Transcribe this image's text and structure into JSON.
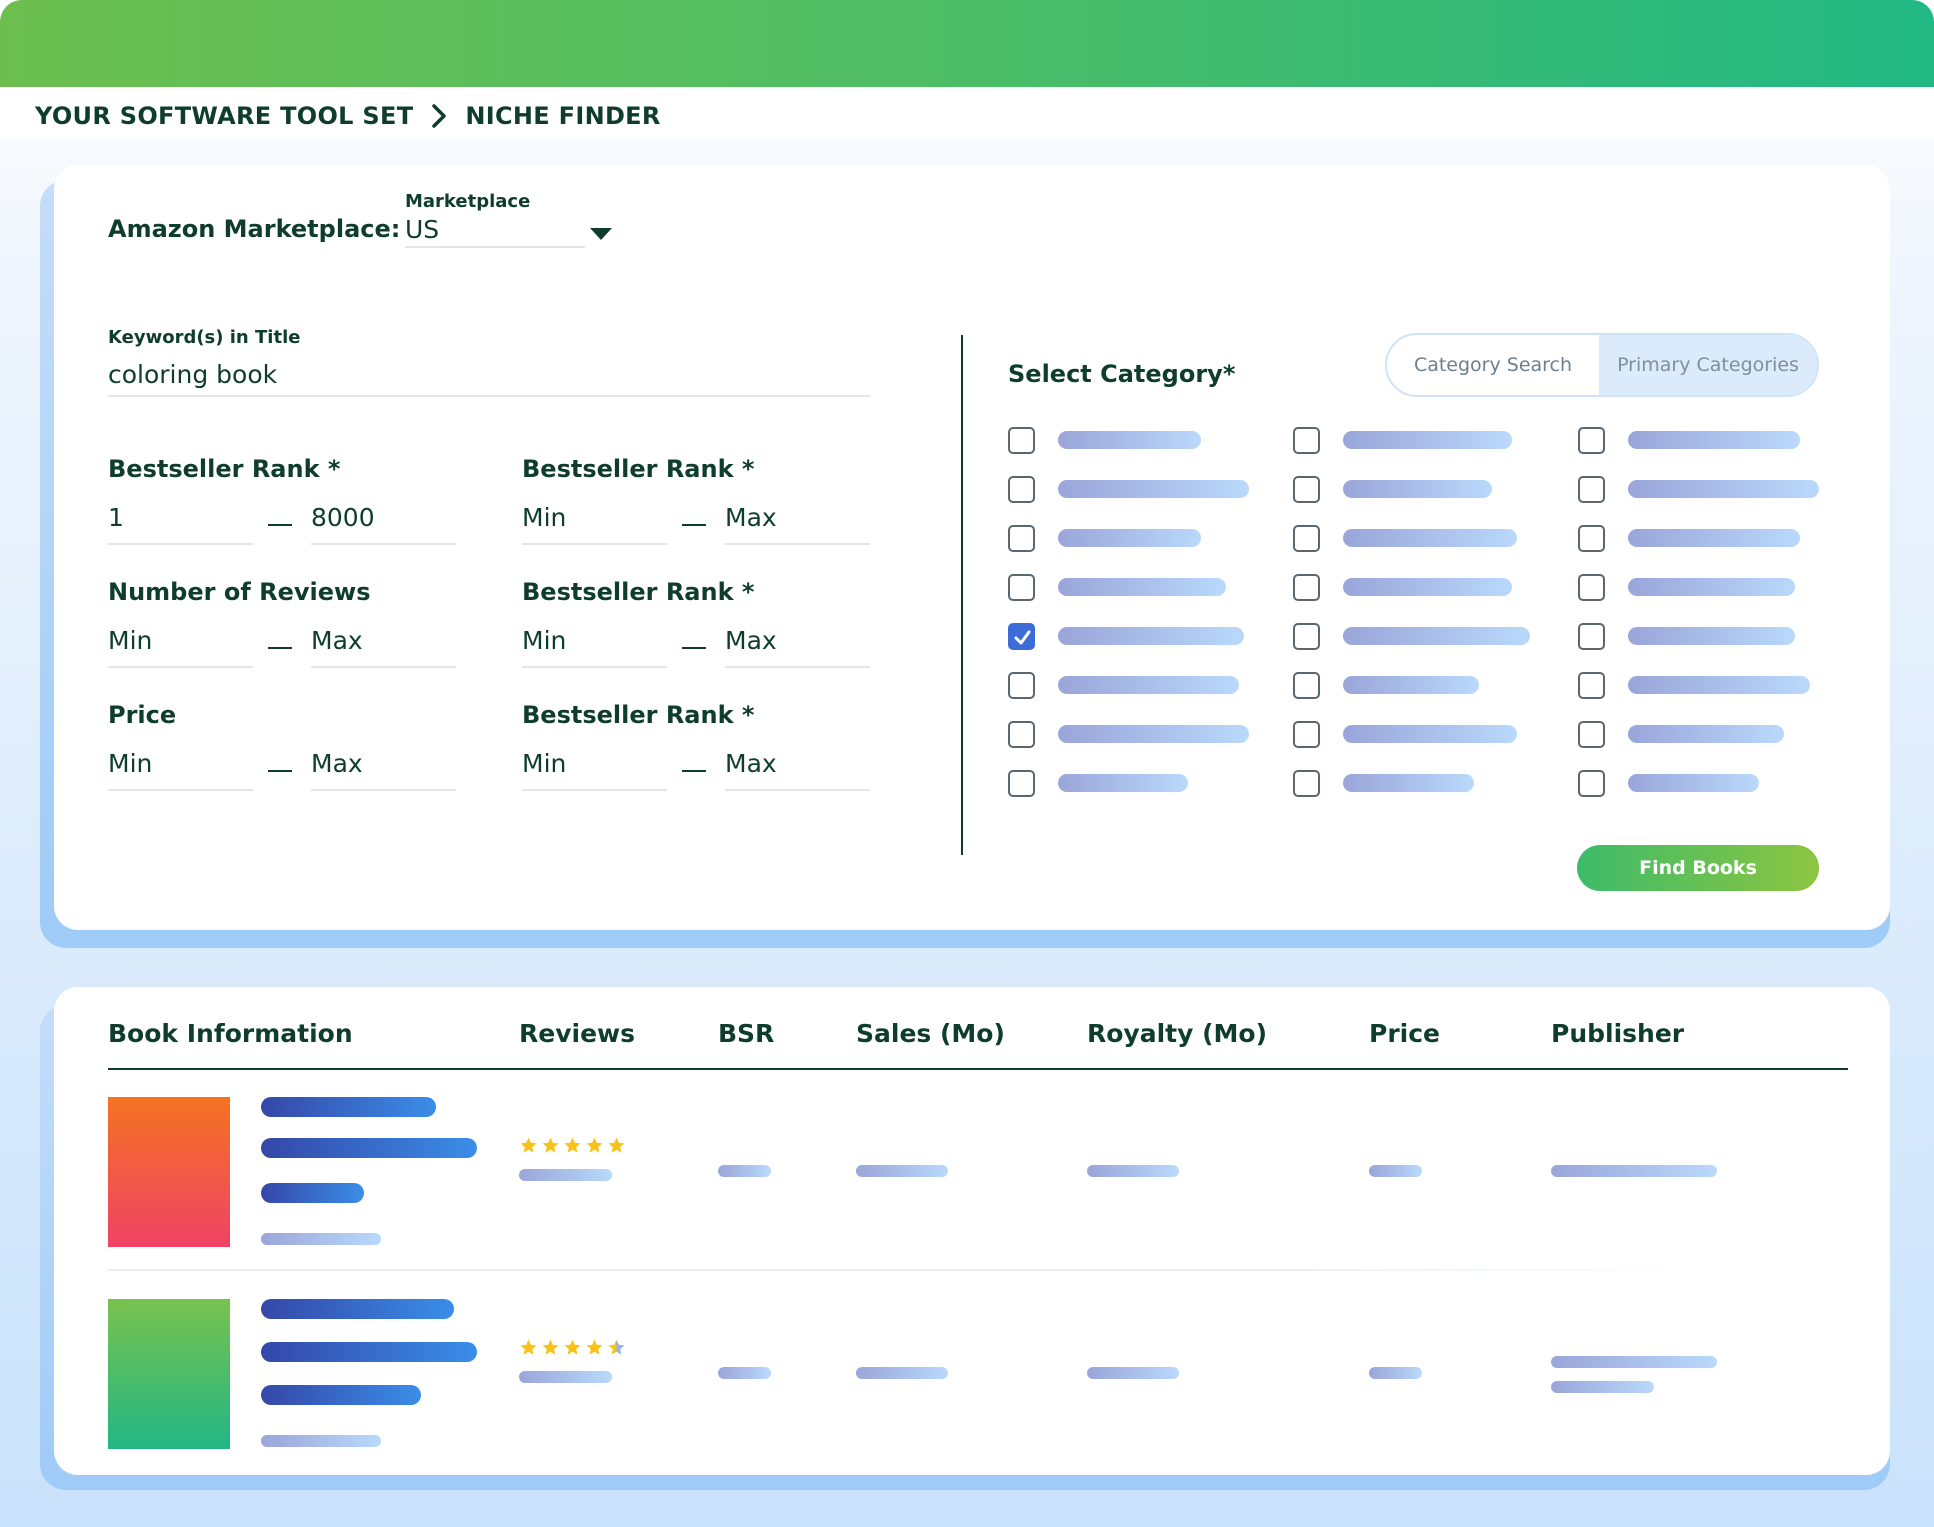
{
  "breadcrumb": {
    "root": "YOUR SOFTWARE TOOL SET",
    "current": "NICHE FINDER"
  },
  "filters": {
    "marketplace_label": "Amazon Marketplace:",
    "marketplace_field_label": "Marketplace",
    "marketplace_value": "US",
    "keyword_label": "Keyword(s) in Title",
    "keyword_value": "coloring book",
    "ranges": [
      {
        "label": "Bestseller Rank *",
        "min": "1",
        "max": "8000"
      },
      {
        "label": "Bestseller Rank *",
        "min": "Min",
        "max": "Max"
      },
      {
        "label": "Number of Reviews",
        "min": "Min",
        "max": "Max"
      },
      {
        "label": "Bestseller Rank *",
        "min": "Min",
        "max": "Max"
      },
      {
        "label": "Price",
        "min": "Min",
        "max": "Max"
      },
      {
        "label": "Bestseller Rank *",
        "min": "Min",
        "max": "Max"
      }
    ]
  },
  "category": {
    "title": "Select Category*",
    "tab_search": "Category Search",
    "tab_primary": "Primary Categories",
    "active_tab": "primary",
    "checked_index": 4,
    "columns": 3,
    "rows": 8
  },
  "actions": {
    "find_books": "Find Books"
  },
  "table": {
    "headers": [
      "Book Information",
      "Reviews",
      "BSR",
      "Sales (Mo)",
      "Royalty (Mo)",
      "Price",
      "Publisher"
    ],
    "rows": [
      {
        "cover_colors": [
          "#f47322",
          "#ef4266"
        ],
        "rating": 5
      },
      {
        "cover_colors": [
          "#78c24e",
          "#22b685"
        ],
        "rating": 4.5
      }
    ]
  },
  "colors": {
    "accent_green": "#4cbd67",
    "text_dark": "#0f3d2b",
    "checkbox_checked": "#3d6bd8",
    "star": "#f7c21a"
  }
}
